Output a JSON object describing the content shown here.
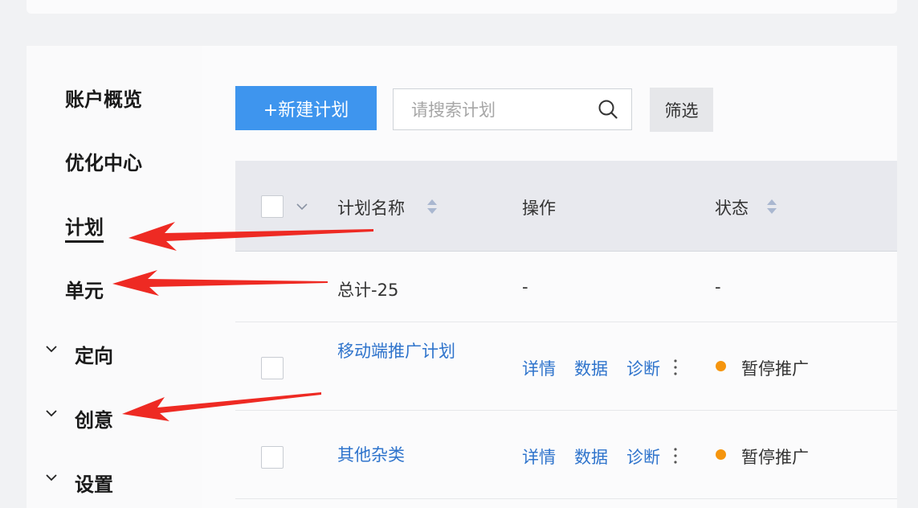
{
  "sidebar": {
    "items": [
      {
        "label": "账户概览"
      },
      {
        "label": "优化中心"
      },
      {
        "label": "计划"
      },
      {
        "label": "单元"
      },
      {
        "label": "定向"
      },
      {
        "label": "创意"
      },
      {
        "label": "设置"
      }
    ]
  },
  "toolbar": {
    "new_plan_label": "+新建计划",
    "search_placeholder": "请搜索计划",
    "filter_label": "筛选"
  },
  "table": {
    "columns": [
      "计划名称",
      "操作",
      "状态"
    ],
    "summary": {
      "name": "总计-25",
      "action": "-",
      "status": "-"
    },
    "rows": [
      {
        "name": "移动端推广计划",
        "actions": [
          "详情",
          "数据",
          "诊断"
        ],
        "status": "暂停推广"
      },
      {
        "name": "其他杂类",
        "actions": [
          "详情",
          "数据",
          "诊断"
        ],
        "status": "暂停推广"
      }
    ]
  },
  "colors": {
    "primary": "#3e95ee",
    "link": "#2f74cc",
    "status_paused": "#f5950e",
    "annotation_arrow": "#ee2a23"
  }
}
